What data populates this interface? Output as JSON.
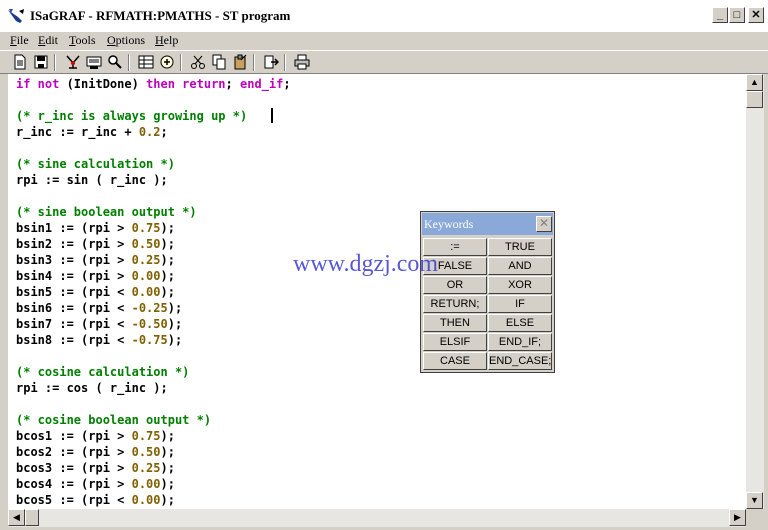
{
  "window": {
    "title": "ISaGRAF - RFMATH:PMATHS - ST program",
    "min_glyph": "_",
    "max_glyph": "□",
    "close_glyph": "✕"
  },
  "menu": {
    "file": {
      "u": "F",
      "rest": "ile"
    },
    "edit": {
      "u": "E",
      "rest": "dit"
    },
    "tools": {
      "u": "T",
      "rest": "ools"
    },
    "options": {
      "u": "O",
      "rest": "ptions"
    },
    "help": {
      "u": "H",
      "rest": "elp"
    }
  },
  "toolbar": {
    "icons": [
      "new-icon",
      "save-icon",
      "compile-icon",
      "print-preview-icon",
      "find-icon",
      "variables-icon",
      "goto-icon",
      "cut-icon",
      "copy-icon",
      "paste-icon",
      "insert-icon",
      "print-icon"
    ]
  },
  "code": {
    "l0": {
      "kw1": "if not",
      "t1": " (InitDone) ",
      "kw2": "then return",
      "t2": "; ",
      "kw3": "end_if",
      "t3": ";"
    },
    "c1": "(* r_inc is always growing up *)",
    "l1": {
      "a": "r_inc := r_inc + ",
      "n": "0.2",
      "b": ";"
    },
    "c2": "(* sine calculation *)",
    "l2": "rpi := sin ( r_inc );",
    "c3": "(* sine boolean output *)",
    "bsin": [
      {
        "a": "bsin1 := (rpi > ",
        "n": "0.75",
        "b": ");"
      },
      {
        "a": "bsin2 := (rpi > ",
        "n": "0.50",
        "b": ");"
      },
      {
        "a": "bsin3 := (rpi > ",
        "n": "0.25",
        "b": ");"
      },
      {
        "a": "bsin4 := (rpi > ",
        "n": "0.00",
        "b": ");"
      },
      {
        "a": "bsin5 := (rpi < ",
        "n": "0.00",
        "b": ");"
      },
      {
        "a": "bsin6 := (rpi < ",
        "n": "-0.25",
        "b": ");"
      },
      {
        "a": "bsin7 := (rpi < ",
        "n": "-0.50",
        "b": ");"
      },
      {
        "a": "bsin8 := (rpi < ",
        "n": "-0.75",
        "b": ");"
      }
    ],
    "c4": "(* cosine calculation *)",
    "l3": "rpi := cos ( r_inc );",
    "c5": "(* cosine boolean output *)",
    "bcos": [
      {
        "a": "bcos1 := (rpi > ",
        "n": "0.75",
        "b": ");"
      },
      {
        "a": "bcos2 := (rpi > ",
        "n": "0.50",
        "b": ");"
      },
      {
        "a": "bcos3 := (rpi > ",
        "n": "0.25",
        "b": ");"
      },
      {
        "a": "bcos4 := (rpi > ",
        "n": "0.00",
        "b": ");"
      },
      {
        "a": "bcos5 := (rpi < ",
        "n": "0.00",
        "b": ");"
      }
    ]
  },
  "keywords": {
    "title": "Keywords",
    "close": "✕",
    "items": [
      ":=",
      "TRUE",
      "FALSE",
      "AND",
      "OR",
      "XOR",
      "RETURN;",
      "IF",
      "THEN",
      "ELSE",
      "ELSIF",
      "END_IF;",
      "CASE",
      "END_CASE;"
    ]
  },
  "watermark": "www.dgzj.com",
  "scroll": {
    "up": "▲",
    "down": "▼",
    "left": "◀",
    "right": "▶"
  },
  "colors": {
    "keyword": "#c000c0",
    "comment": "#008000",
    "number": "#806000",
    "panel_title": "#8aa8d8"
  }
}
